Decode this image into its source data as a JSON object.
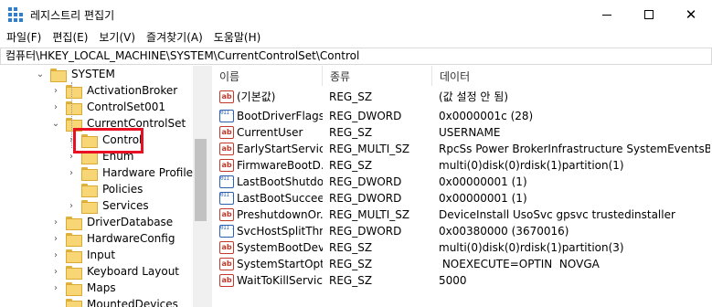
{
  "window": {
    "title": "레지스트리 편집기",
    "minimize_glyph": "—",
    "maximize_glyph": "☐",
    "close_glyph": "✕"
  },
  "menu": [
    {
      "label": "파일(F)"
    },
    {
      "label": "편집(E)"
    },
    {
      "label": "보기(V)"
    },
    {
      "label": "즐겨찾기(A)"
    },
    {
      "label": "도움말(H)"
    }
  ],
  "address": "컴퓨터\\HKEY_LOCAL_MACHINE\\SYSTEM\\CurrentControlSet\\Control",
  "tree": [
    {
      "label": "SYSTEM",
      "chevron": "⌄"
    },
    {
      "label": "ActivationBroker",
      "chevron": "›"
    },
    {
      "label": "ControlSet001",
      "chevron": "›"
    },
    {
      "label": "CurrentControlSet",
      "chevron": "⌄"
    },
    {
      "label": "Control",
      "chevron": "›"
    },
    {
      "label": "Enum",
      "chevron": "›"
    },
    {
      "label": "Hardware Profiles",
      "chevron": "›"
    },
    {
      "label": "Policies",
      "chevron": ""
    },
    {
      "label": "Services",
      "chevron": "›"
    },
    {
      "label": "DriverDatabase",
      "chevron": "›"
    },
    {
      "label": "HardwareConfig",
      "chevron": "›"
    },
    {
      "label": "Input",
      "chevron": "›"
    },
    {
      "label": "Keyboard Layout",
      "chevron": "›"
    },
    {
      "label": "Maps",
      "chevron": "›"
    },
    {
      "label": "MountedDevices",
      "chevron": ""
    }
  ],
  "columns": {
    "name": "이름",
    "type": "종류",
    "data": "데이터"
  },
  "values": [
    {
      "name": "(기본값)",
      "type": "REG_SZ",
      "data": "(값 설정 안 됨)",
      "icon": "string-value-icon"
    },
    {
      "name": "BootDriverFlags",
      "type": "REG_DWORD",
      "data": "0x0000001c (28)",
      "icon": "binary-value-icon"
    },
    {
      "name": "CurrentUser",
      "type": "REG_SZ",
      "data": "USERNAME",
      "icon": "string-value-icon"
    },
    {
      "name": "EarlyStartServices",
      "type": "REG_MULTI_SZ",
      "data": "RpcSs Power BrokerInfrastructure SystemEventsBr...",
      "icon": "string-value-icon"
    },
    {
      "name": "FirmwareBootD...",
      "type": "REG_SZ",
      "data": "multi(0)disk(0)rdisk(1)partition(1)",
      "icon": "string-value-icon"
    },
    {
      "name": "LastBootShutdo...",
      "type": "REG_DWORD",
      "data": "0x00000001 (1)",
      "icon": "binary-value-icon"
    },
    {
      "name": "LastBootSuccee...",
      "type": "REG_DWORD",
      "data": "0x00000001 (1)",
      "icon": "binary-value-icon"
    },
    {
      "name": "PreshutdownOr...",
      "type": "REG_MULTI_SZ",
      "data": "DeviceInstall UsoSvc gpsvc trustedinstaller",
      "icon": "string-value-icon"
    },
    {
      "name": "SvcHostSplitThr...",
      "type": "REG_DWORD",
      "data": "0x00380000 (3670016)",
      "icon": "binary-value-icon"
    },
    {
      "name": "SystemBootDev...",
      "type": "REG_SZ",
      "data": "multi(0)disk(0)rdisk(1)partition(3)",
      "icon": "string-value-icon"
    },
    {
      "name": "SystemStartOpti...",
      "type": "REG_SZ",
      "data": " NOEXECUTE=OPTIN  NOVGA",
      "icon": "string-value-icon"
    },
    {
      "name": "WaitToKillServic...",
      "type": "REG_SZ",
      "data": "5000",
      "icon": "string-value-icon"
    }
  ],
  "icons": {
    "string_glyph": "ab",
    "binary_glyph": "011 110"
  },
  "colors": {
    "highlight_outline": "#e81123",
    "folder": "#f8d675"
  }
}
